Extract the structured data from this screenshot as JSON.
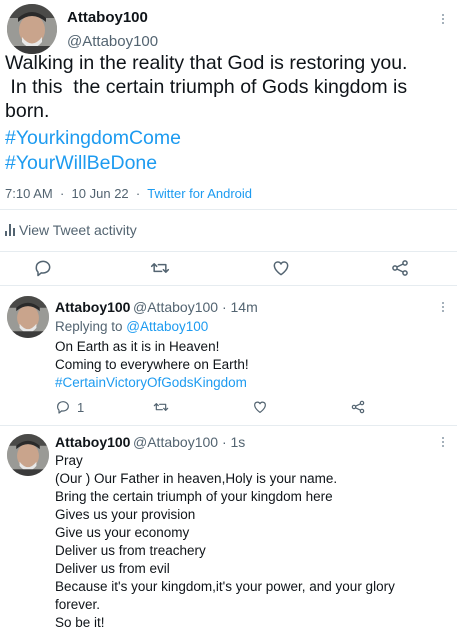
{
  "main_tweet": {
    "display_name": "Attaboy100",
    "handle": "@Attaboy100",
    "text_lines": [
      "Walking in the reality that God is restoring you.",
      " In this  the certain triumph of Gods kingdom is",
      "born."
    ],
    "hashtags": [
      "#YourkingdomCome",
      "#YourWillBeDone"
    ],
    "time": "7:10 AM",
    "date": "10 Jun 22",
    "separator": "·",
    "source": "Twitter for Android",
    "activity_label": "View Tweet activity",
    "colors": {
      "link": "#1d9bf0",
      "muted": "#536471",
      "divider": "#e6ecf0"
    }
  },
  "replies": [
    {
      "display_name": "Attaboy100",
      "handle": "@Attaboy100",
      "separator": "·",
      "age": "14m",
      "replying_to_prefix": "Replying to ",
      "replying_to_handle": "@Attaboy100",
      "lines": [
        "On Earth as it is in Heaven!",
        "Coming to everywhere on Earth!"
      ],
      "hashtag": "#CertainVictoryOfGodsKingdom",
      "reply_count": "1"
    },
    {
      "display_name": "Attaboy100",
      "handle": "@Attaboy100",
      "separator": "·",
      "age": "1s",
      "lines": [
        "Pray",
        "(Our ) Our Father in heaven,Holy is your name.",
        "Bring the certain triumph of your kingdom here",
        "Gives us your provision",
        "Give us your economy",
        "Deliver us from treachery",
        "Deliver us from evil",
        "Because it's your kingdom,it's your power, and your glory",
        "forever.",
        "So be it!"
      ]
    }
  ],
  "icons": {
    "avatar": "avatar-photo",
    "more": "more-vertical-icon",
    "activity": "bar-chart-icon",
    "reply": "reply-bubble-icon",
    "retweet": "retweet-icon",
    "like": "heart-icon",
    "share": "share-icon"
  }
}
